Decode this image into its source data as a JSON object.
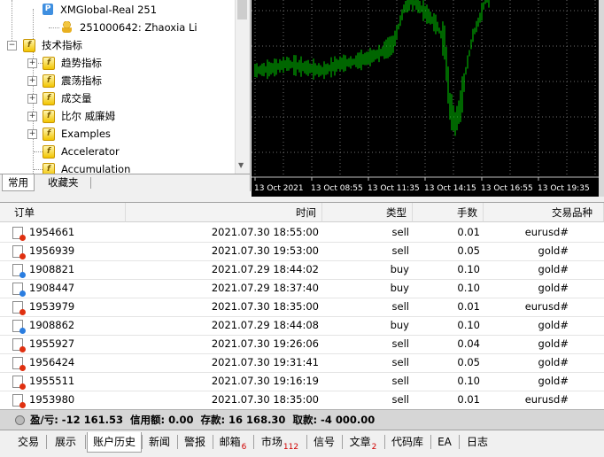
{
  "navigator": {
    "account_server": "XMGlobal-Real 251",
    "account_user": "251000642: Zhaoxia Li",
    "indicators_root": "技术指标",
    "items": [
      {
        "label": "趋势指标"
      },
      {
        "label": "震荡指标"
      },
      {
        "label": "成交量"
      },
      {
        "label": "比尔 威廉姆"
      },
      {
        "label": "Examples"
      },
      {
        "label": "Accelerator"
      },
      {
        "label": "Accumulation"
      }
    ],
    "tabs": {
      "common": "常用",
      "favorites": "收藏夹"
    }
  },
  "chart": {
    "time_labels": [
      "13 Oct 2021",
      "13 Oct 08:55",
      "13 Oct 11:35",
      "13 Oct 14:15",
      "13 Oct 16:55",
      "13 Oct 19:35"
    ],
    "bar_color": "#00cc00",
    "grid_color": "#6e6e6e"
  },
  "orders": {
    "headers": {
      "order": "订单",
      "time": "时间",
      "type": "类型",
      "lots": "手数",
      "symbol": "交易品种"
    },
    "rows": [
      {
        "order": "1954661",
        "time": "2021.07.30 18:55:00",
        "type": "sell",
        "lots": "0.01",
        "symbol": "eurusd#"
      },
      {
        "order": "1956939",
        "time": "2021.07.30 19:53:00",
        "type": "sell",
        "lots": "0.05",
        "symbol": "gold#"
      },
      {
        "order": "1908821",
        "time": "2021.07.29 18:44:02",
        "type": "buy",
        "lots": "0.10",
        "symbol": "gold#"
      },
      {
        "order": "1908447",
        "time": "2021.07.29 18:37:40",
        "type": "buy",
        "lots": "0.10",
        "symbol": "gold#"
      },
      {
        "order": "1953979",
        "time": "2021.07.30 18:35:00",
        "type": "sell",
        "lots": "0.01",
        "symbol": "eurusd#"
      },
      {
        "order": "1908862",
        "time": "2021.07.29 18:44:08",
        "type": "buy",
        "lots": "0.10",
        "symbol": "gold#"
      },
      {
        "order": "1955927",
        "time": "2021.07.30 19:26:06",
        "type": "sell",
        "lots": "0.04",
        "symbol": "gold#"
      },
      {
        "order": "1956424",
        "time": "2021.07.30 19:31:41",
        "type": "sell",
        "lots": "0.05",
        "symbol": "gold#"
      },
      {
        "order": "1955511",
        "time": "2021.07.30 19:16:19",
        "type": "sell",
        "lots": "0.10",
        "symbol": "gold#"
      },
      {
        "order": "1953980",
        "time": "2021.07.30 18:35:00",
        "type": "sell",
        "lots": "0.01",
        "symbol": "eurusd#"
      }
    ],
    "sell_icon_color": "#e03010",
    "buy_icon_color": "#2a7de0"
  },
  "summary": {
    "text": "盈/亏: -12 161.53  信用额: 0.00  存款: 16 168.30  取款: -4 000.00"
  },
  "bottom_tabs": [
    {
      "label": "交易",
      "badge": ""
    },
    {
      "label": "展示",
      "badge": ""
    },
    {
      "label": "账户历史",
      "badge": ""
    },
    {
      "label": "新闻",
      "badge": ""
    },
    {
      "label": "警报",
      "badge": ""
    },
    {
      "label": "邮箱",
      "badge": "6"
    },
    {
      "label": "市场",
      "badge": "112"
    },
    {
      "label": "信号",
      "badge": ""
    },
    {
      "label": "文章",
      "badge": "2"
    },
    {
      "label": "代码库",
      "badge": ""
    },
    {
      "label": "EA",
      "badge": ""
    },
    {
      "label": "日志",
      "badge": ""
    }
  ],
  "active_bottom_tab": "账户历史"
}
